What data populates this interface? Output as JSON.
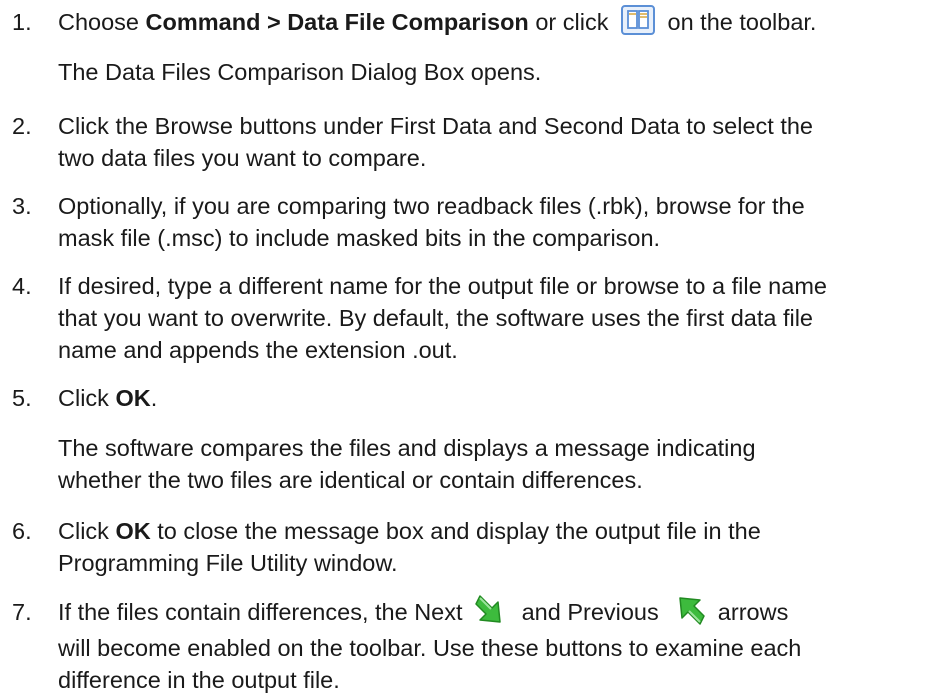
{
  "steps": [
    {
      "number": "1.",
      "pre": "Choose ",
      "bold": "Command > Data File Comparison",
      "mid": " or click ",
      "post": " on the toolbar.",
      "result": "The Data Files Comparison Dialog Box opens."
    },
    {
      "number": "2.",
      "line1": "Click the Browse buttons under First Data and Second Data to select the",
      "line2": "two data files you want to compare."
    },
    {
      "number": "3.",
      "line1": "Optionally, if you are comparing two readback files (.rbk), browse for the",
      "line2": "mask file (.msc) to include masked bits in the comparison."
    },
    {
      "number": "4.",
      "line1": "If desired, type a different name for the output file or browse to a file name",
      "line2": "that you want to overwrite. By default, the software uses the first data file",
      "line3": "name and appends the extension .out."
    },
    {
      "number": "5.",
      "pre": "Click ",
      "bold": "OK",
      "post": ".",
      "result_line1": "The software compares the files and displays a message indicating",
      "result_line2": "whether the two files are identical or contain differences."
    },
    {
      "number": "6.",
      "pre": "Click ",
      "bold": "OK",
      "post": " to close the message box and display the output file in the",
      "line2": "Programming File Utility window."
    },
    {
      "number": "7.",
      "pre": "If the files contain differences, the Next ",
      "mid": " and Previous ",
      "post": " arrows",
      "line2": "will become enabled on the toolbar. Use these buttons to examine each",
      "line3": "difference in the output file."
    }
  ],
  "icons": {
    "compare": "data-file-comparison-icon",
    "next": "next-difference-arrow-icon",
    "previous": "previous-difference-arrow-icon"
  },
  "colors": {
    "text": "#1a1a1a",
    "icon_blue": "#5b8fd6",
    "arrow_green": "#3dbb3d"
  }
}
